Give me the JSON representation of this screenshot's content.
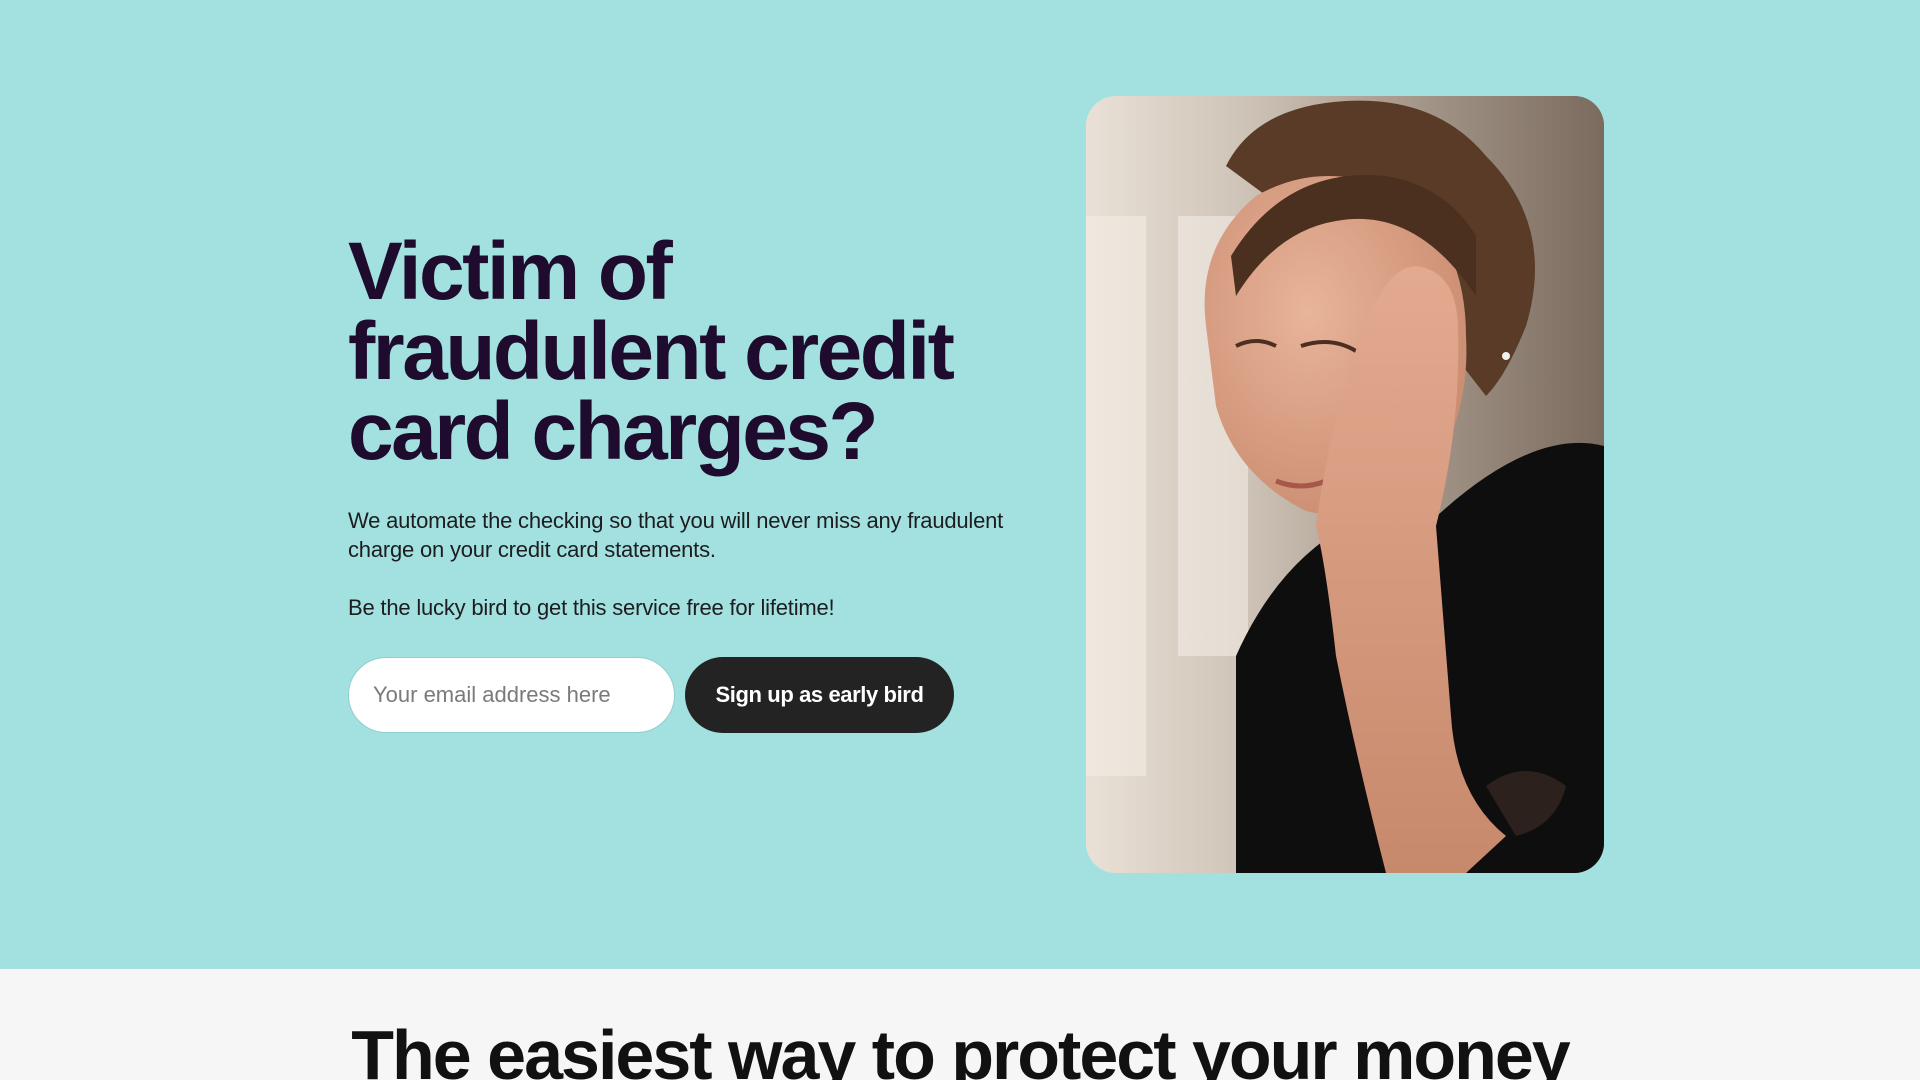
{
  "hero": {
    "headline_lines": [
      "Victim of",
      "fraudulent credit",
      "card charges?"
    ],
    "description": "We automate the checking so that you will never miss any fraudulent charge on your credit card statements.",
    "promo": "Be the lucky bird to get this service free for lifetime!",
    "email_placeholder": "Your email address here",
    "email_value": "",
    "signup_label": "Sign up as early bird",
    "image_alt": "Worried woman resting her head on her hand"
  },
  "section": {
    "title": "The easiest way to protect your money"
  },
  "colors": {
    "hero_background": "#a2e1e0",
    "headline": "#1f0b2d",
    "button": "#232323",
    "section_background": "#f6f6f6"
  }
}
